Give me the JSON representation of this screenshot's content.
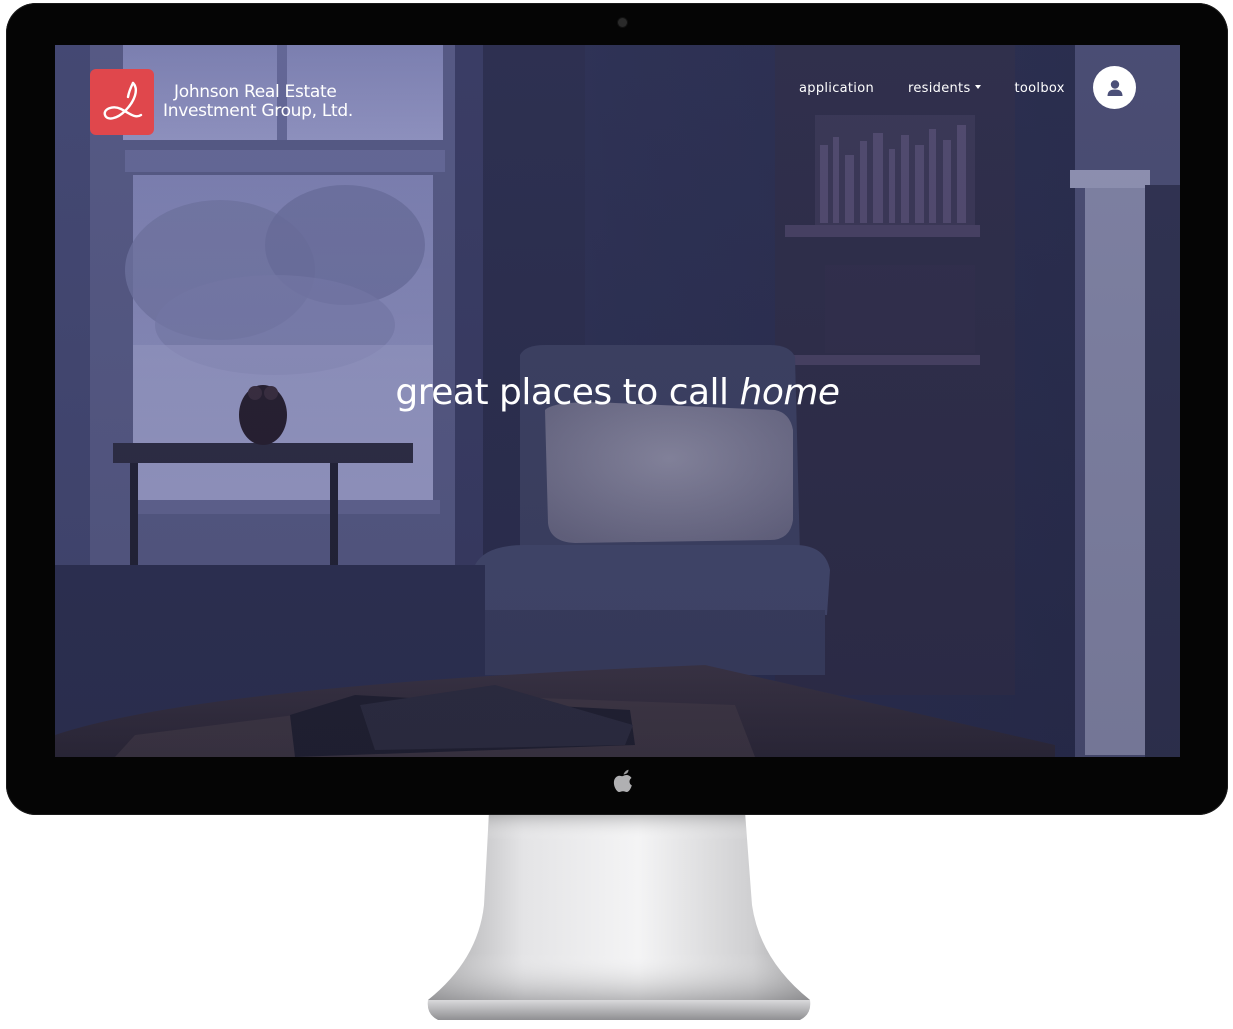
{
  "brand": {
    "line1": "Johnson Real Estate",
    "line2": "Investment Group, Ltd.",
    "logo_color": "#e0474c",
    "logo_icon": "swirl-logo-icon"
  },
  "nav": {
    "items": [
      {
        "label": "application"
      },
      {
        "label": "residents",
        "has_dropdown": true
      },
      {
        "label": "toolbox"
      }
    ],
    "account_icon": "user-icon"
  },
  "hero": {
    "text_main": "great places to call ",
    "text_emphasis": "home"
  },
  "device": {
    "type": "desktop monitor",
    "logo_icon": "apple-icon"
  }
}
